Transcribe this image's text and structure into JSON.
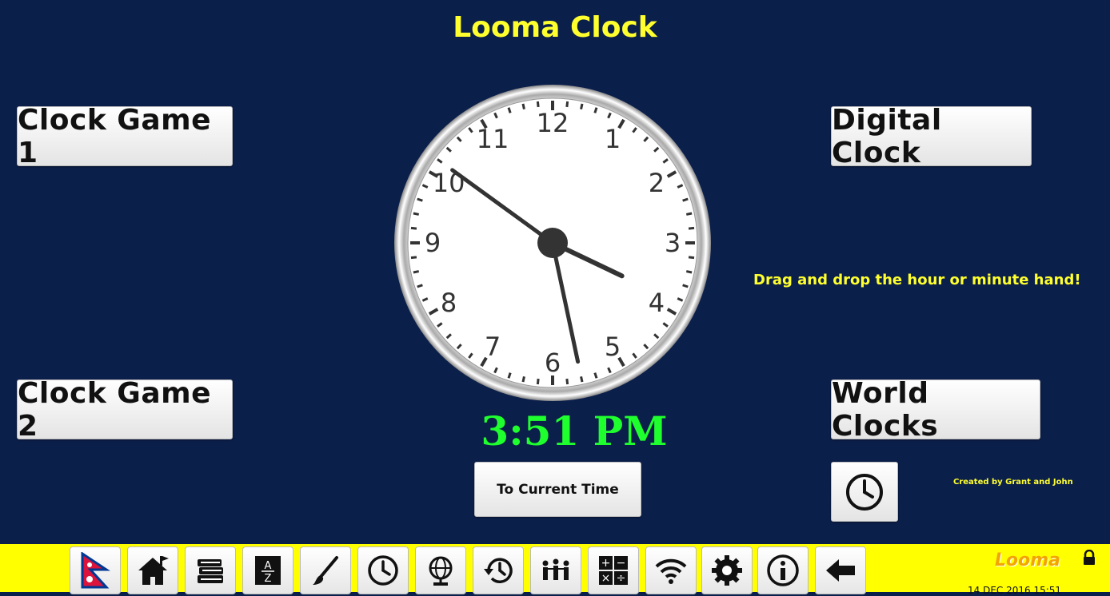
{
  "title": "Looma Clock",
  "buttons": {
    "clock_game_1": "Clock Game 1",
    "clock_game_2": "Clock Game 2",
    "digital_clock": "Digital Clock",
    "world_clocks": "World Clocks",
    "to_current_time": "To Current Time"
  },
  "hint": "Drag and drop the hour or minute hand!",
  "credit": "Created by Grant and John",
  "digital_time": "3:51 PM",
  "clock": {
    "numbers": [
      "12",
      "1",
      "2",
      "3",
      "4",
      "5",
      "6",
      "7",
      "8",
      "9",
      "10",
      "11"
    ],
    "hour": 3,
    "minute": 51
  },
  "toolbar": {
    "items": [
      "nepal-flag-icon",
      "home-icon",
      "books-icon",
      "dictionary-icon",
      "paintbrush-icon",
      "clock-icon",
      "globe-icon",
      "history-icon",
      "people-icon",
      "calculator-icon",
      "wifi-icon",
      "gear-icon",
      "info-icon",
      "back-arrow-icon"
    ],
    "logo": "Looma",
    "datetime": "14 DEC 2016 15:51"
  },
  "colors": {
    "background": "#0b1f4b",
    "title": "#ffff2e",
    "digital_time": "#1fff2e",
    "toolbar": "#ffff00"
  }
}
